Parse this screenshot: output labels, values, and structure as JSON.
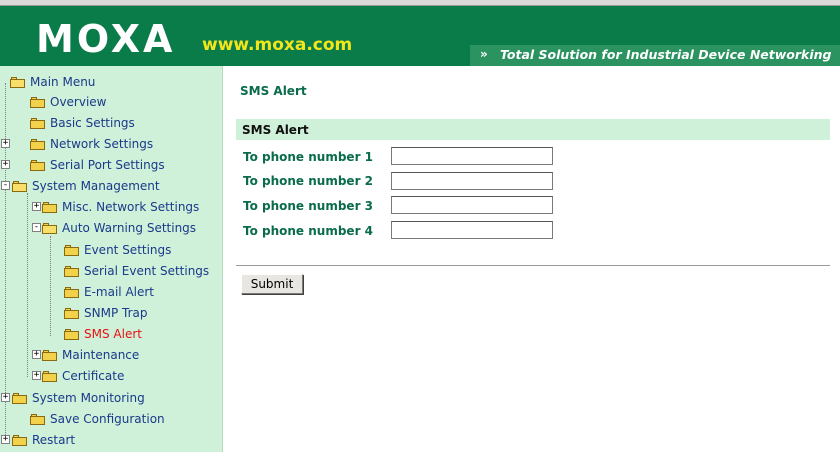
{
  "header": {
    "logo": "MOXA",
    "site_url": "www.moxa.com",
    "tagline_arrow": "»",
    "tagline": "Total Solution for Industrial Device Networking"
  },
  "sidebar": {
    "items": [
      {
        "label": "Main Menu",
        "expander": "",
        "active": false
      },
      {
        "label": "Overview",
        "expander": "",
        "active": false
      },
      {
        "label": "Basic Settings",
        "expander": "",
        "active": false
      },
      {
        "label": "Network Settings",
        "expander": "+",
        "active": false
      },
      {
        "label": "Serial Port Settings",
        "expander": "+",
        "active": false
      },
      {
        "label": "System Management",
        "expander": "-",
        "active": false
      },
      {
        "label": "Misc. Network Settings",
        "expander": "+",
        "active": false
      },
      {
        "label": "Auto Warning Settings",
        "expander": "-",
        "active": false
      },
      {
        "label": "Event Settings",
        "expander": "",
        "active": false
      },
      {
        "label": "Serial Event Settings",
        "expander": "",
        "active": false
      },
      {
        "label": "E-mail Alert",
        "expander": "",
        "active": false
      },
      {
        "label": "SNMP Trap",
        "expander": "",
        "active": false
      },
      {
        "label": "SMS Alert",
        "expander": "",
        "active": true
      },
      {
        "label": "Maintenance",
        "expander": "+",
        "active": false
      },
      {
        "label": "Certificate",
        "expander": "+",
        "active": false
      },
      {
        "label": "System Monitoring",
        "expander": "+",
        "active": false
      },
      {
        "label": "Save Configuration",
        "expander": "",
        "active": false
      },
      {
        "label": "Restart",
        "expander": "+",
        "active": false
      }
    ]
  },
  "main": {
    "page_title": "SMS Alert",
    "section_title": "SMS Alert",
    "fields": [
      {
        "label": "To phone number 1",
        "value": ""
      },
      {
        "label": "To phone number 2",
        "value": ""
      },
      {
        "label": "To phone number 3",
        "value": ""
      },
      {
        "label": "To phone number 4",
        "value": ""
      }
    ],
    "submit_label": "Submit"
  },
  "colors": {
    "header_bg": "#0a7c4a",
    "sidebar_bg": "#cff0d9",
    "label_green": "#0a6c4a",
    "active_red": "#e81212",
    "url_yellow": "#f4e51a"
  }
}
